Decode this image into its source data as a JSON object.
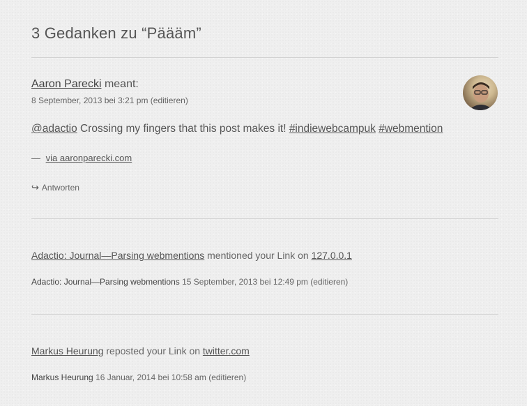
{
  "heading": "3 Gedanken zu “Päääm”",
  "comment": {
    "author": "Aaron Parecki",
    "verb": "meant:",
    "date": "8 September, 2013 bei 3:21 pm",
    "edit": "(editieren)",
    "text_parts": {
      "mention": "@adactio",
      "body": " Crossing my fingers that this post makes it! ",
      "tag1": "#indiewebcampuk",
      "tag2": "#webmention"
    },
    "via_dash": "—",
    "via_link": "via aaronparecki.com",
    "reply_icon": "reply-arrow-icon",
    "reply_label": "Antworten"
  },
  "mentions": [
    {
      "link": "Adactio: Journal—Parsing webmentions",
      "mid": " mentioned your Link on ",
      "target": "127.0.0.1",
      "author": "Adactio: Journal—Parsing webmentions",
      "date": "15 September, 2013 bei 12:49 pm",
      "edit": "(editieren)"
    },
    {
      "link": "Markus Heurung",
      "mid": " reposted your Link on ",
      "target": "twitter.com",
      "author": "Markus Heurung",
      "date": "16 Januar, 2014 bei 10:58 am",
      "edit": "(editieren)"
    }
  ]
}
